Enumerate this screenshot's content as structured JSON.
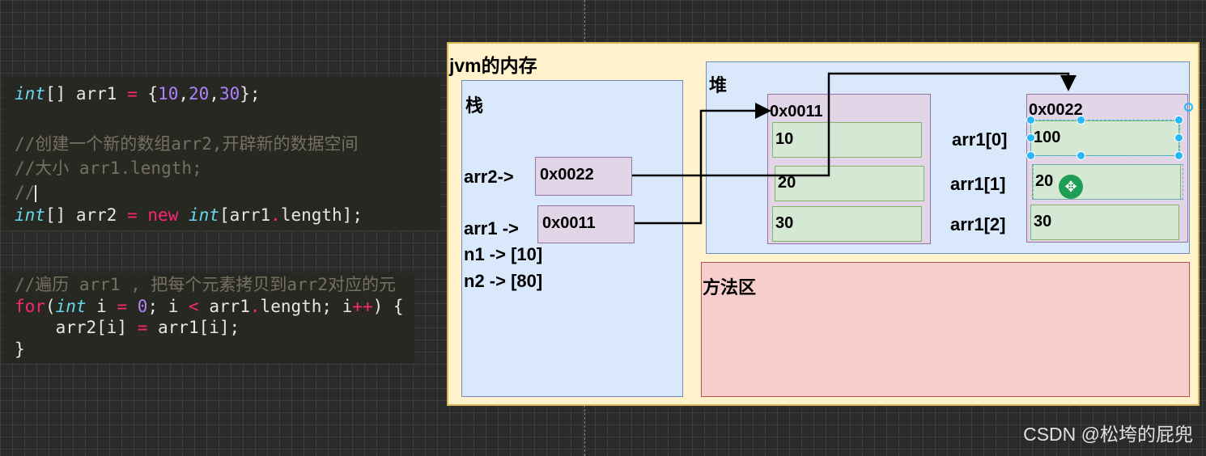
{
  "code_block_1": {
    "lines": {
      "l1": {
        "t1": "int",
        "t2": "[] arr1 ",
        "t3": "=",
        "t4": " {",
        "t5": "10",
        "t6": ",",
        "t7": "20",
        "t8": ",",
        "t9": "30",
        "t10": "};"
      },
      "l2": "//创建一个新的数组arr2,开辟新的数据空间",
      "l3": "//大小 arr1.length;",
      "l4": "//",
      "l5": {
        "t1": "int",
        "t2": "[] arr2 ",
        "t3": "=",
        "t4": " ",
        "t5": "new",
        "t6": " ",
        "t7": "int",
        "t8": "[arr1",
        "t9": ".",
        "t10": "length];"
      }
    }
  },
  "code_block_2": {
    "lines": {
      "l1": "//遍历 arr1 , 把每个元素拷贝到arr2对应的元",
      "l2": {
        "t1": "for",
        "t2": "(",
        "t3": "int",
        "t4": " i ",
        "t5": "=",
        "t6": " ",
        "t7": "0",
        "t8": "; i ",
        "t9": "<",
        "t10": " arr1",
        "t11": ".",
        "t12": "length; i",
        "t13": "++",
        "t14": ") {"
      },
      "l3": {
        "t1": "    arr2[i] ",
        "t2": "=",
        "t3": " arr1[i];"
      },
      "l4": "}"
    }
  },
  "diagram": {
    "jvm_title": "jvm的内存",
    "stack": {
      "title": "栈",
      "arr2_label": "arr2->",
      "arr2_value": "0x0022",
      "arr1_label": "arr1 ->",
      "arr1_value": "0x0011",
      "n1": "n1 -> [10]",
      "n2": "n2 -> [80]"
    },
    "heap": {
      "title": "堆",
      "array_a": {
        "address": "0x0011",
        "cells": [
          "10",
          "20",
          "30"
        ]
      },
      "array_b": {
        "address": "0x0022",
        "cells": [
          "100",
          "20",
          "30"
        ],
        "index_labels": [
          "arr1[0]",
          "arr1[1]",
          "arr1[2]"
        ]
      }
    },
    "method_area": {
      "title": "方法区"
    }
  },
  "watermark": "CSDN @松垮的屁兜",
  "colors": {
    "stack_fill": "#dae8fc",
    "heap_fill": "#dae8fc",
    "method_fill": "#f8cecc",
    "jvm_fill": "#fff2cc",
    "ref_fill": "#e1d5e7",
    "cell_fill": "#d5e8d4",
    "selection": "#29b6f6"
  },
  "icons": {
    "move_cursor": "move-cursor-icon",
    "rotate_handle": "rotate-handle-icon"
  }
}
